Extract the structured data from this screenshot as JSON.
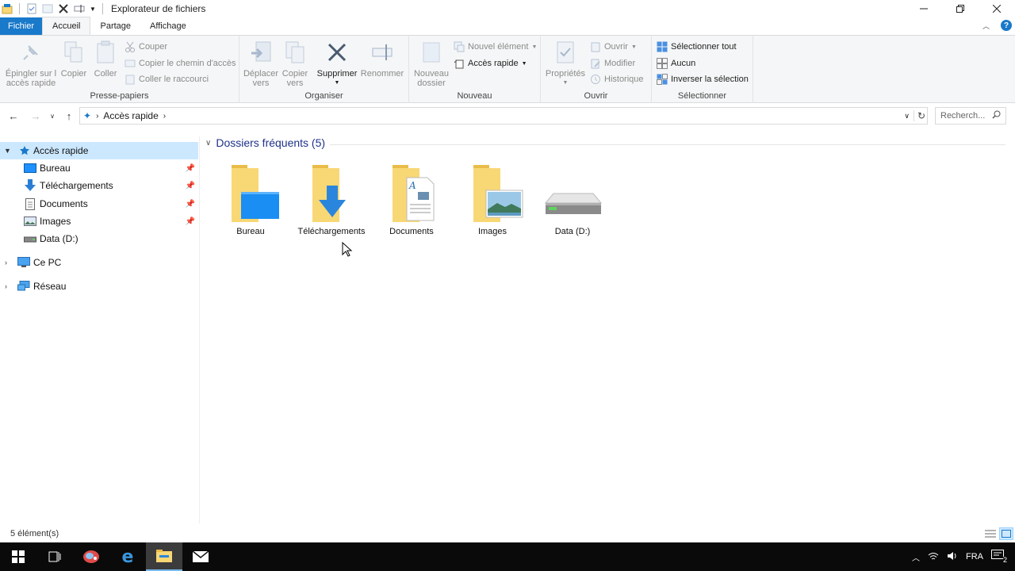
{
  "window": {
    "title": "Explorateur de fichiers"
  },
  "ribbon_tabs": [
    {
      "label": "Fichier"
    },
    {
      "label": "Accueil"
    },
    {
      "label": "Partage"
    },
    {
      "label": "Affichage"
    }
  ],
  "ribbon": {
    "presse_papiers": {
      "label": "Presse-papiers",
      "pin_line1": "Épingler sur l",
      "pin_line2": "accès rapide",
      "copy": "Copier",
      "paste": "Coller",
      "cut": "Couper",
      "copy_path": "Copier le chemin d'accès",
      "paste_shortcut": "Coller le raccourci"
    },
    "organiser": {
      "label": "Organiser",
      "move_line1": "Déplacer",
      "move_line2": "vers",
      "copyto_line1": "Copier",
      "copyto_line2": "vers",
      "delete": "Supprimer",
      "rename": "Renommer"
    },
    "nouveau": {
      "label": "Nouveau",
      "newfolder_line1": "Nouveau",
      "newfolder_line2": "dossier",
      "new_item": "Nouvel élément",
      "quick_access": "Accès rapide"
    },
    "ouvrir": {
      "label": "Ouvrir",
      "properties": "Propriétés",
      "open": "Ouvrir",
      "edit": "Modifier",
      "history": "Historique"
    },
    "selectionner": {
      "label": "Sélectionner",
      "select_all": "Sélectionner tout",
      "select_none": "Aucun",
      "invert": "Inverser la sélection"
    }
  },
  "address": {
    "path": "Accès rapide",
    "search_placeholder": "Recherch..."
  },
  "nav": {
    "quick_access": "Accès rapide",
    "items": [
      {
        "label": "Bureau",
        "pinned": true
      },
      {
        "label": "Téléchargements",
        "pinned": true
      },
      {
        "label": "Documents",
        "pinned": true
      },
      {
        "label": "Images",
        "pinned": true
      },
      {
        "label": "Data (D:)",
        "pinned": false
      }
    ],
    "this_pc": "Ce PC",
    "network": "Réseau"
  },
  "content": {
    "section_title": "Dossiers fréquents (5)",
    "tiles": [
      {
        "label": "Bureau",
        "icon": "desktop-folder-icon"
      },
      {
        "label": "Téléchargements",
        "icon": "downloads-folder-icon"
      },
      {
        "label": "Documents",
        "icon": "documents-folder-icon"
      },
      {
        "label": "Images",
        "icon": "pictures-folder-icon"
      },
      {
        "label": "Data (D:)",
        "icon": "drive-icon"
      }
    ]
  },
  "status": {
    "count": "5 élément(s)"
  },
  "taskbar": {
    "lang": "FRA",
    "notif_count": "2"
  },
  "colors": {
    "accent": "#1979ca",
    "selection": "#cce8ff",
    "folder": "#f8d775",
    "header_text": "#1e3287"
  }
}
